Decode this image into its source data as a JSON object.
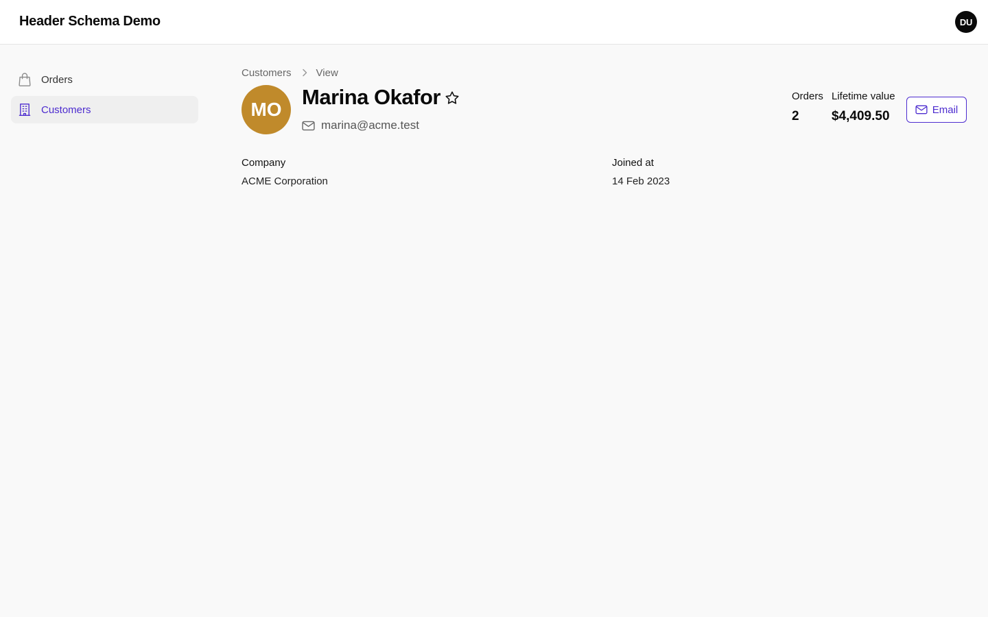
{
  "header": {
    "app_title": "Header Schema Demo",
    "user_initials": "DU"
  },
  "sidebar": {
    "items": [
      {
        "label": "Orders",
        "icon": "shopping-bag-icon",
        "active": false
      },
      {
        "label": "Customers",
        "icon": "building-icon",
        "active": true
      }
    ]
  },
  "breadcrumb": {
    "items": [
      "Customers",
      "View"
    ]
  },
  "customer": {
    "initials": "MO",
    "name": "Marina Okafor",
    "email": "marina@acme.test",
    "avatar_color": "#c08a2b"
  },
  "stats": {
    "orders_label": "Orders",
    "orders_value": "2",
    "lifetime_label": "Lifetime value",
    "lifetime_value": "$4,409.50"
  },
  "actions": {
    "email_label": "Email"
  },
  "details": {
    "company_label": "Company",
    "company_value": "ACME Corporation",
    "joined_label": "Joined at",
    "joined_value": "14 Feb 2023"
  },
  "colors": {
    "accent": "#4c2bcf",
    "active_nav_bg": "#efefef"
  }
}
